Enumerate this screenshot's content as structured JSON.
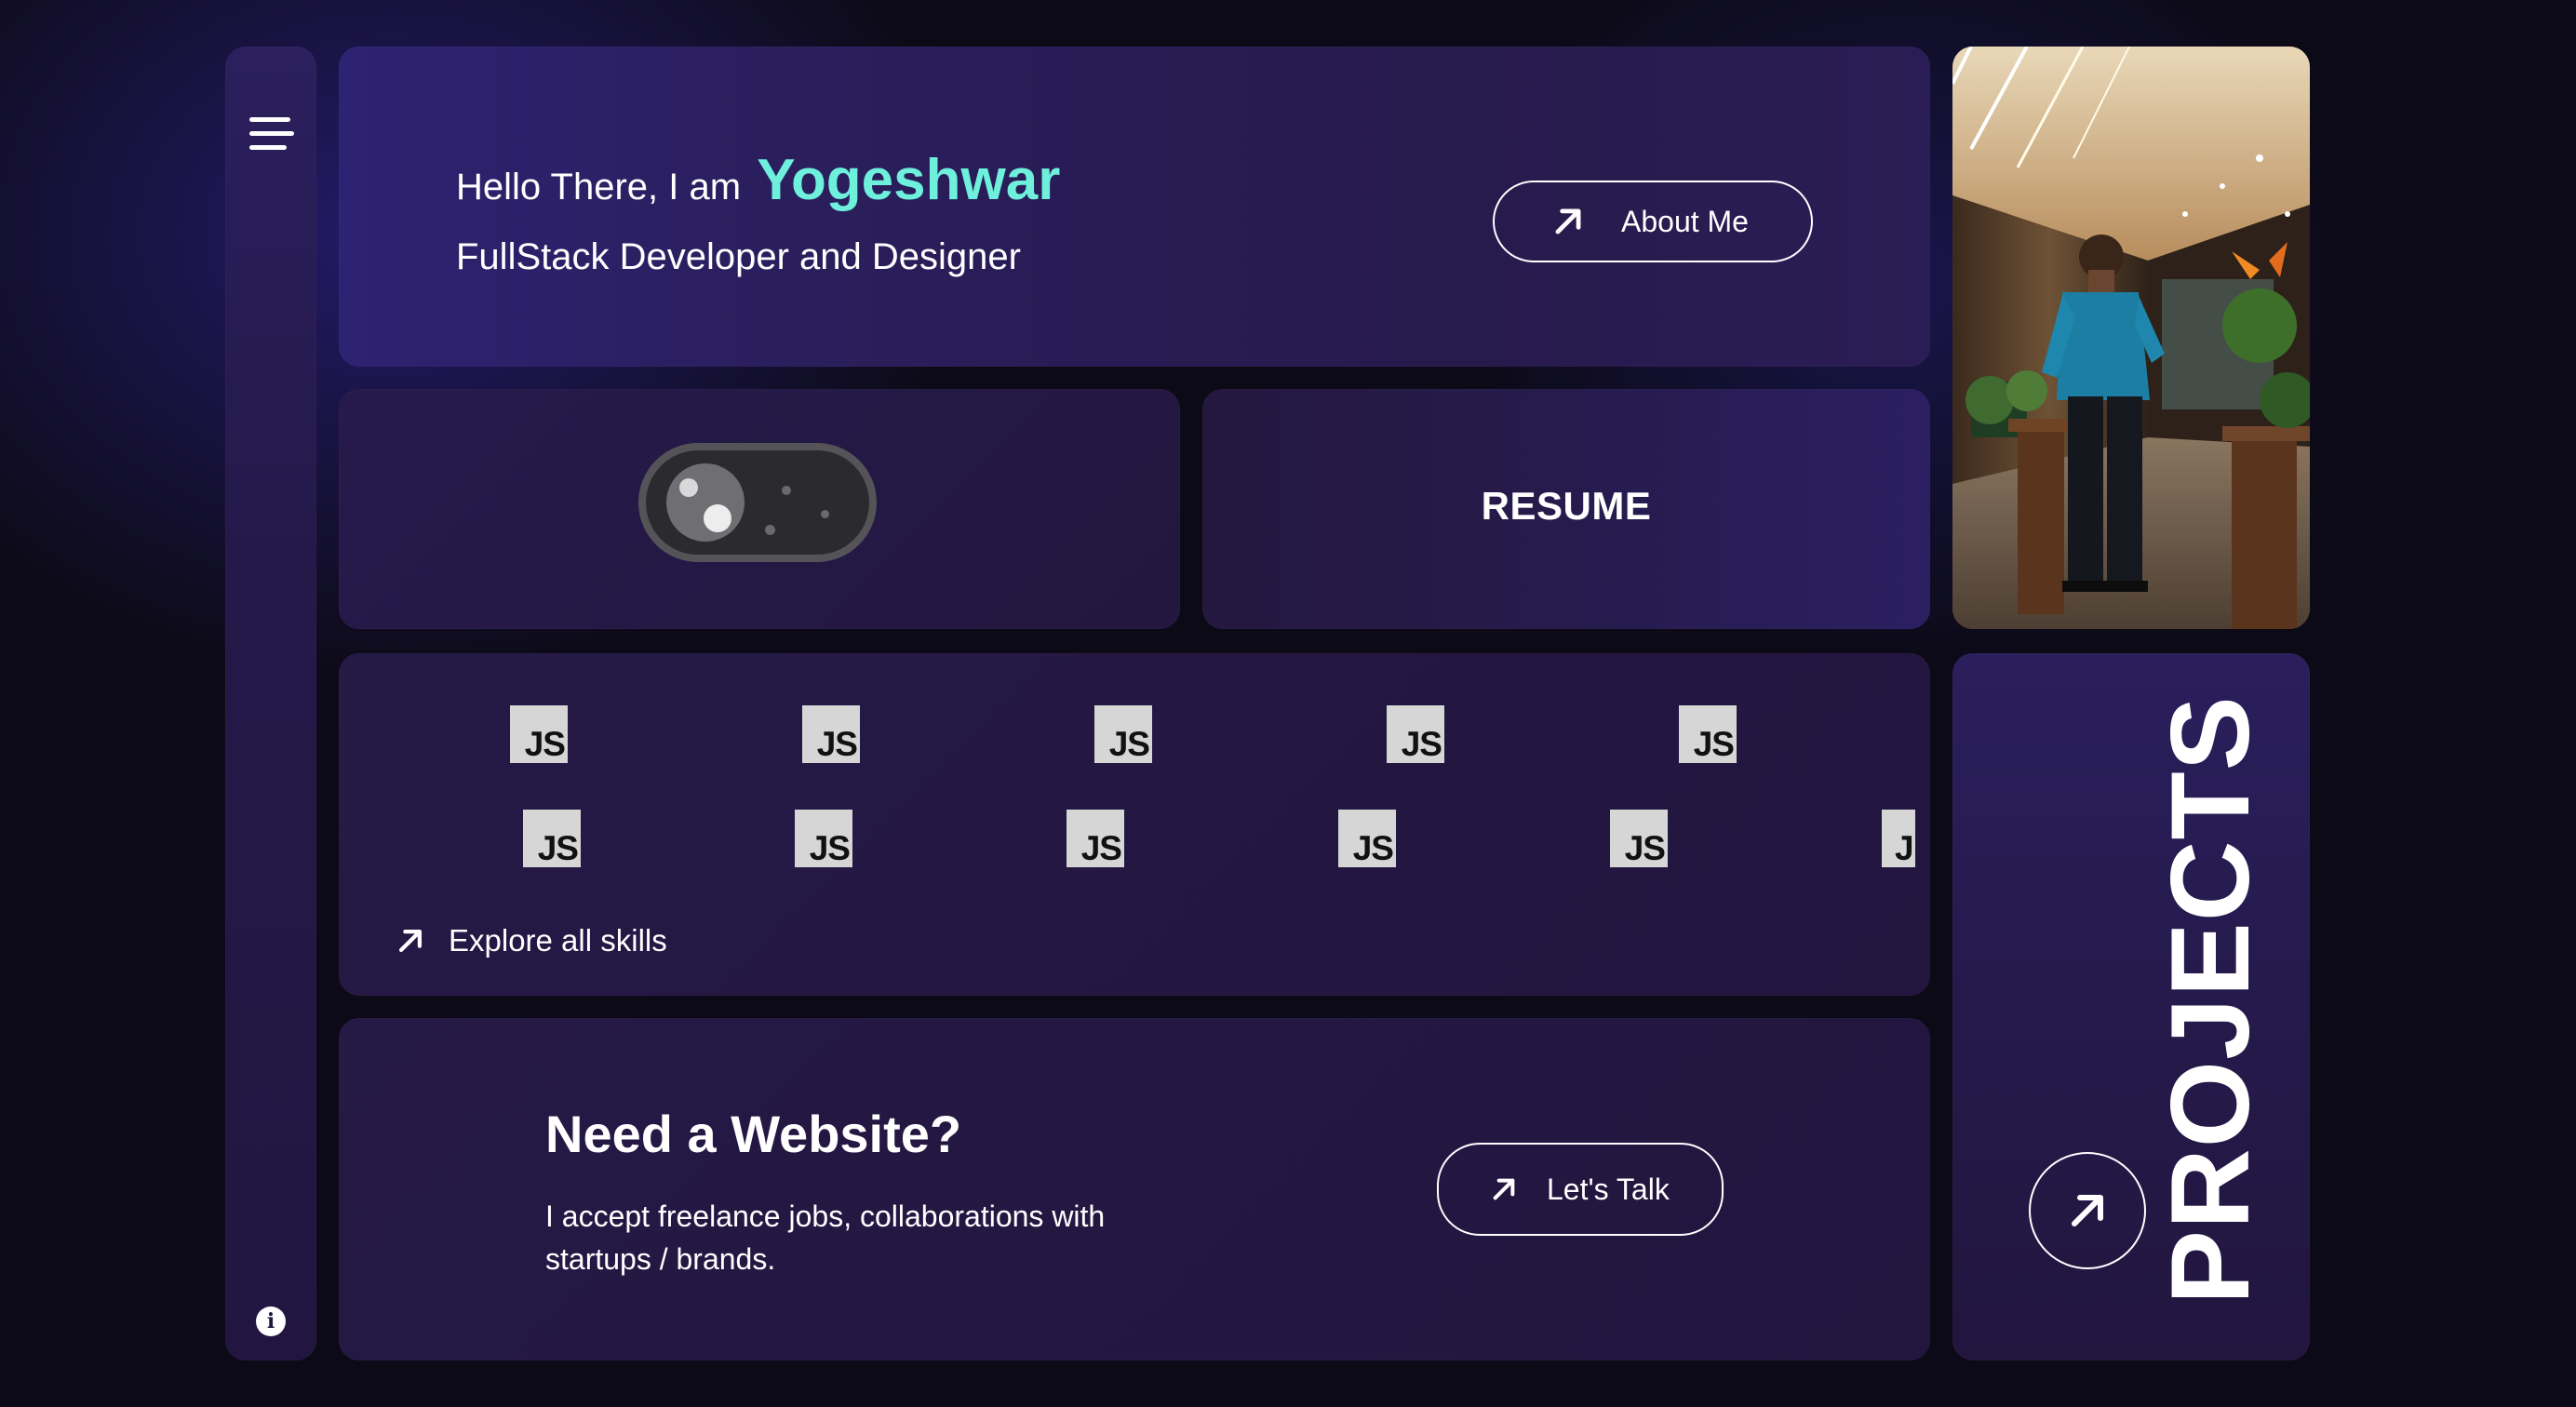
{
  "sidebar": {
    "menu_icon": "hamburger-menu-icon",
    "info_icon": "info-icon",
    "info_glyph": "i"
  },
  "hero": {
    "greeting": "Hello There, I am",
    "name": "Yogeshwar",
    "role": "FullStack Developer and Designer",
    "about_button": "About Me",
    "name_color": "#6ef0dc"
  },
  "theme_toggle": {
    "icon": "moon-toggle-icon"
  },
  "resume": {
    "label": "RESUME"
  },
  "photo": {
    "icon": "profile-photo"
  },
  "skills": {
    "row1": [
      "JS",
      "JS",
      "JS",
      "JS",
      "JS"
    ],
    "row2": [
      "JS",
      "JS",
      "JS",
      "JS",
      "JS",
      "J"
    ],
    "explore_link": "Explore all skills"
  },
  "website": {
    "title": "Need a Website?",
    "description": "I accept freelance jobs, collaborations with startups / brands.",
    "cta_button": "Let's Talk"
  },
  "projects": {
    "label": "PROJECTS"
  },
  "colors": {
    "background": "#0c0a16",
    "card": "#261a4c",
    "accent": "#6ef0dc"
  }
}
